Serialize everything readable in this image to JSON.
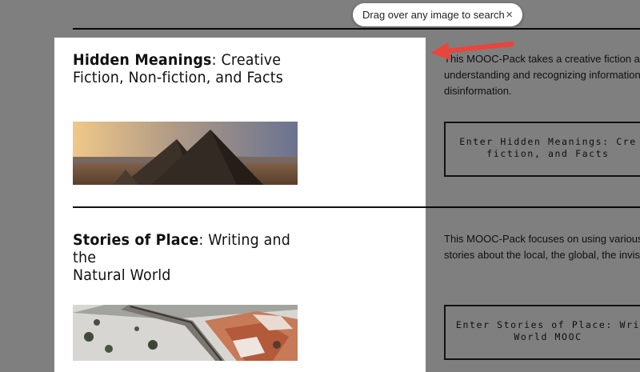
{
  "courses": [
    {
      "title_bold": "Hidden Meanings",
      "title_rest": ": Creative Fiction, Non-fiction, and Facts",
      "description_lines": [
        "This MOOC-Pack takes a creative fiction and",
        "understanding and recognizing information,",
        "disinformation."
      ],
      "button_lines": [
        "Enter Hidden Meanings: Cre",
        "fiction, and Facts"
      ]
    },
    {
      "title_bold": "Stories of Place",
      "title_rest_line1": ": Writing and",
      "title_rest_line2": "the",
      "title_rest_line3": "Natural World",
      "description_lines": [
        "This MOOC-Pack focuses on using various typ",
        "stories about the local, the global, the invisib"
      ],
      "button_lines": [
        "Enter Stories of Place: Wri",
        "World MOOC"
      ]
    }
  ],
  "lens_tooltip": {
    "text": "Drag over any image to search",
    "close": "×"
  },
  "colors": {
    "overlay": "#808080",
    "arrow": "#e8453c"
  }
}
